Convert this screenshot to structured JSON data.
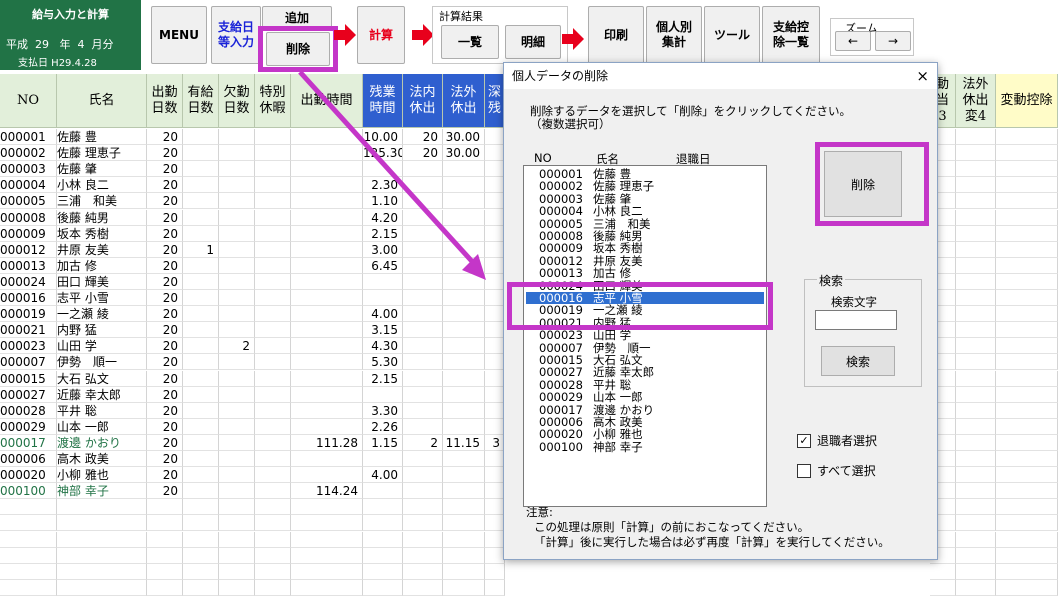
{
  "ribbon": {
    "title": "給与入力と計算",
    "era": "平成",
    "year": "29",
    "year_unit": "年",
    "month": "4",
    "month_unit": "月分",
    "paydate": "支払日 H29.4.28",
    "menu": "MENU",
    "pay_entry_1": "支給日",
    "pay_entry_2": "等入力",
    "add": "追加",
    "delete": "削除",
    "calc": "計算",
    "results_label": "計算結果",
    "list": "一覧",
    "detail": "明細",
    "print": "印刷",
    "personal_1": "個人別",
    "personal_2": "集計",
    "tools": "ツール",
    "deduct_1": "支給控",
    "deduct_2": "除一覧",
    "zoom": "ズーム",
    "zoom_left": "←",
    "zoom_right": "→"
  },
  "sheet": {
    "headers": {
      "no": "NO",
      "name": "氏名",
      "days1": "出勤",
      "days2": "日数",
      "paid1": "有給",
      "paid2": "日数",
      "absent1": "欠勤",
      "absent2": "日数",
      "special1": "特別",
      "special2": "休暇",
      "hours": "出勤時間",
      "ot1": "残業",
      "ot2": "時間",
      "legal_in1": "法内",
      "legal_in2": "休出",
      "legal_out1": "法外",
      "legal_out2": "休出",
      "late1": "深",
      "late2": "残",
      "x1": "動",
      "x2": "当",
      "x3": "3",
      "legal_out_b1": "法外",
      "legal_out_b2": "休出",
      "legal_out_b3": "変4",
      "var_deduct": "変動控除"
    },
    "rows": [
      {
        "no": "000001",
        "name": "佐藤 豊",
        "days": "20",
        "paid": "",
        "absent": "",
        "hours": "",
        "ot": "10.00",
        "in": "20",
        "out": "30.00",
        "late": ""
      },
      {
        "no": "000002",
        "name": "佐藤 理恵子",
        "days": "20",
        "paid": "",
        "absent": "",
        "hours": "",
        "ot": "125.30",
        "in": "20",
        "out": "30.00",
        "late": ""
      },
      {
        "no": "000003",
        "name": "佐藤 肇",
        "days": "20",
        "paid": "",
        "absent": "",
        "hours": "",
        "ot": "",
        "in": "",
        "out": "",
        "late": ""
      },
      {
        "no": "000004",
        "name": "小林 良二",
        "days": "20",
        "paid": "",
        "absent": "",
        "hours": "",
        "ot": "2.30",
        "in": "",
        "out": "",
        "late": ""
      },
      {
        "no": "000005",
        "name": "三浦　和美",
        "days": "20",
        "paid": "",
        "absent": "",
        "hours": "",
        "ot": "1.10",
        "in": "",
        "out": "",
        "late": ""
      },
      {
        "no": "000008",
        "name": "後藤 純男",
        "days": "20",
        "paid": "",
        "absent": "",
        "hours": "",
        "ot": "4.20",
        "in": "",
        "out": "",
        "late": ""
      },
      {
        "no": "000009",
        "name": "坂本 秀樹",
        "days": "20",
        "paid": "",
        "absent": "",
        "hours": "",
        "ot": "2.15",
        "in": "",
        "out": "",
        "late": ""
      },
      {
        "no": "000012",
        "name": "井原 友美",
        "days": "20",
        "paid": "1",
        "absent": "",
        "hours": "",
        "ot": "3.00",
        "in": "",
        "out": "",
        "late": ""
      },
      {
        "no": "000013",
        "name": "加古 修",
        "days": "20",
        "paid": "",
        "absent": "",
        "hours": "",
        "ot": "6.45",
        "in": "",
        "out": "",
        "late": ""
      },
      {
        "no": "000024",
        "name": "田口 輝美",
        "days": "20",
        "paid": "",
        "absent": "",
        "hours": "",
        "ot": "",
        "in": "",
        "out": "",
        "late": ""
      },
      {
        "no": "000016",
        "name": "志平 小雪",
        "days": "20",
        "paid": "",
        "absent": "",
        "hours": "",
        "ot": "",
        "in": "",
        "out": "",
        "late": ""
      },
      {
        "no": "000019",
        "name": "一之瀬 綾",
        "days": "20",
        "paid": "",
        "absent": "",
        "hours": "",
        "ot": "4.00",
        "in": "",
        "out": "",
        "late": ""
      },
      {
        "no": "000021",
        "name": "内野 猛",
        "days": "20",
        "paid": "",
        "absent": "",
        "hours": "",
        "ot": "3.15",
        "in": "",
        "out": "",
        "late": ""
      },
      {
        "no": "000023",
        "name": "山田 学",
        "days": "20",
        "paid": "",
        "absent": "2",
        "hours": "",
        "ot": "4.30",
        "in": "",
        "out": "",
        "late": ""
      },
      {
        "no": "000007",
        "name": "伊勢　順一",
        "days": "20",
        "paid": "",
        "absent": "",
        "hours": "",
        "ot": "5.30",
        "in": "",
        "out": "",
        "late": ""
      },
      {
        "no": "000015",
        "name": "大石 弘文",
        "days": "20",
        "paid": "",
        "absent": "",
        "hours": "",
        "ot": "2.15",
        "in": "",
        "out": "",
        "late": ""
      },
      {
        "no": "000027",
        "name": "近藤 幸太郎",
        "days": "20",
        "paid": "",
        "absent": "",
        "hours": "",
        "ot": "",
        "in": "",
        "out": "",
        "late": ""
      },
      {
        "no": "000028",
        "name": "平井 聡",
        "days": "20",
        "paid": "",
        "absent": "",
        "hours": "",
        "ot": "3.30",
        "in": "",
        "out": "",
        "late": ""
      },
      {
        "no": "000029",
        "name": "山本 一郎",
        "days": "20",
        "paid": "",
        "absent": "",
        "hours": "",
        "ot": "2.26",
        "in": "",
        "out": "",
        "late": ""
      },
      {
        "no": "000017",
        "name": "渡邊 かおり",
        "days": "20",
        "paid": "",
        "absent": "",
        "hours": "111.28",
        "ot": "1.15",
        "in": "2",
        "out": "11.15",
        "late": "3",
        "green": true
      },
      {
        "no": "000006",
        "name": "高木 政美",
        "days": "20",
        "paid": "",
        "absent": "",
        "hours": "",
        "ot": "",
        "in": "",
        "out": "",
        "late": ""
      },
      {
        "no": "000020",
        "name": "小柳 雅也",
        "days": "20",
        "paid": "",
        "absent": "",
        "hours": "",
        "ot": "4.00",
        "in": "",
        "out": "",
        "late": ""
      },
      {
        "no": "000100",
        "name": "神部 幸子",
        "days": "20",
        "paid": "",
        "absent": "",
        "hours": "114.24",
        "ot": "",
        "in": "",
        "out": "",
        "late": "",
        "green": true
      }
    ]
  },
  "dialog": {
    "title": "個人データの削除",
    "close": "×",
    "instruction1": "削除するデータを選択して「削除」をクリックしてください。",
    "instruction2": "（複数選択可）",
    "col_no": "NO",
    "col_name": "氏名",
    "col_retire": "退職日",
    "items": [
      {
        "no": "000001",
        "name": "佐藤 豊"
      },
      {
        "no": "000002",
        "name": "佐藤 理恵子"
      },
      {
        "no": "000003",
        "name": "佐藤 肇"
      },
      {
        "no": "000004",
        "name": "小林 良二"
      },
      {
        "no": "000005",
        "name": "三浦　和美"
      },
      {
        "no": "000008",
        "name": "後藤 純男"
      },
      {
        "no": "000009",
        "name": "坂本 秀樹"
      },
      {
        "no": "000012",
        "name": "井原 友美"
      },
      {
        "no": "000013",
        "name": "加古 修"
      },
      {
        "no": "000024",
        "name": "田口 輝美"
      },
      {
        "no": "000016",
        "name": "志平 小雪",
        "selected": true
      },
      {
        "no": "000019",
        "name": "一之瀬 綾"
      },
      {
        "no": "000021",
        "name": "内野 猛"
      },
      {
        "no": "000023",
        "name": "山田 学"
      },
      {
        "no": "000007",
        "name": "伊勢　順一"
      },
      {
        "no": "000015",
        "name": "大石 弘文"
      },
      {
        "no": "000027",
        "name": "近藤 幸太郎"
      },
      {
        "no": "000028",
        "name": "平井 聡"
      },
      {
        "no": "000029",
        "name": "山本 一郎"
      },
      {
        "no": "000017",
        "name": "渡邊 かおり"
      },
      {
        "no": "000006",
        "name": "高木 政美"
      },
      {
        "no": "000020",
        "name": "小柳 雅也"
      },
      {
        "no": "000100",
        "name": "神部 幸子"
      }
    ],
    "delete_button": "削除",
    "search_group": "検索",
    "search_label": "検索文字",
    "search_value": "",
    "search_button": "検索",
    "retired_label": "退職者選択",
    "retired_checked": true,
    "select_all_label": "すべて選択",
    "select_all_checked": false,
    "note_title": "注意:",
    "note1": "この処理は原則「計算」の前におこなってください。",
    "note2": "「計算」後に実行した場合は必ず再度「計算」を実行してください。"
  },
  "colors": {
    "highlight": "#c436c8",
    "green": "#217346",
    "selection": "#2f6fd0"
  }
}
